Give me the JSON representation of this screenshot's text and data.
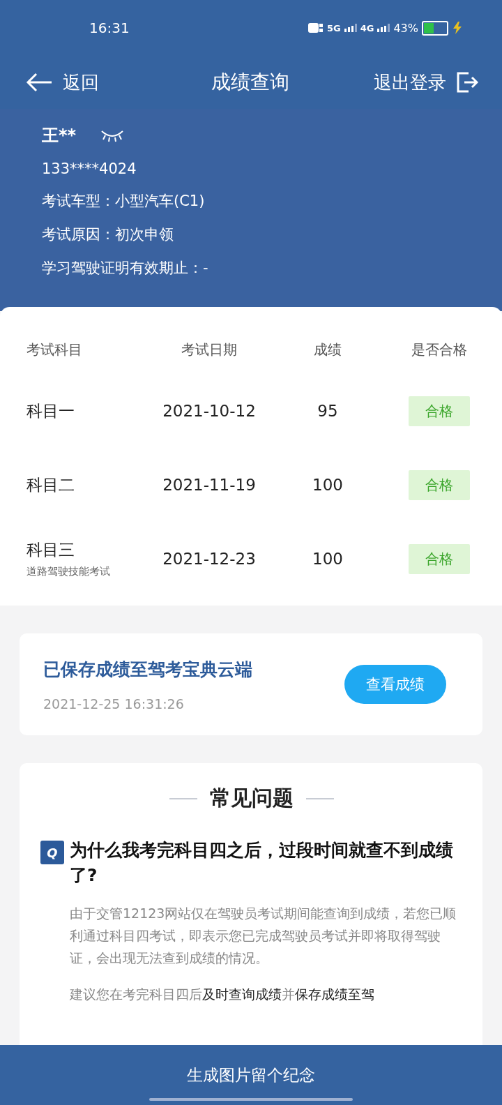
{
  "status_bar": {
    "time": "16:31",
    "network_1": "5G",
    "network_2": "4G",
    "battery_percent": "43%",
    "charging": true
  },
  "nav": {
    "back": "返回",
    "title": "成绩查询",
    "logout": "退出登录"
  },
  "profile": {
    "name": "王**",
    "phone": "133****4024",
    "lines": [
      "考试车型：小型汽车(C1)",
      "考试原因：初次申领",
      "学习驾驶证明有效期止：-"
    ]
  },
  "table": {
    "columns": [
      "考试科目",
      "考试日期",
      "成绩",
      "是否合格"
    ],
    "rows": [
      {
        "subject": "科目一",
        "date": "2021-10-12",
        "score": "95",
        "result": "合格",
        "passed": true
      },
      {
        "subject": "科目二",
        "date": "2021-11-19",
        "score": "100",
        "result": "合格",
        "passed": true
      },
      {
        "subject": "科目三",
        "note": "道路驾驶技能考试",
        "date": "2021-12-23",
        "score": "100",
        "result": "合格",
        "passed": true
      }
    ]
  },
  "cloud": {
    "title": "已保存成绩至驾考宝典云端",
    "time": "2021-12-25 16:31:26",
    "button": "查看成绩"
  },
  "faq": {
    "title": "常见问题",
    "question": "为什么我考完科目四之后，过段时间就查不到成绩了?",
    "badge": "Q",
    "paragraphs": [
      "由于交管12123网站仅在驾驶员考试期间能查询到成绩，若您已顺利通过科目四考试，即表示您已完成驾驶员考试并即将取得驾驶证，会出现无法查到成绩的情况。",
      "建议您在考完科目四后**及时查询成绩**并**保存成绩至驾**"
    ]
  },
  "bottom_button": "生成图片留个纪念"
}
